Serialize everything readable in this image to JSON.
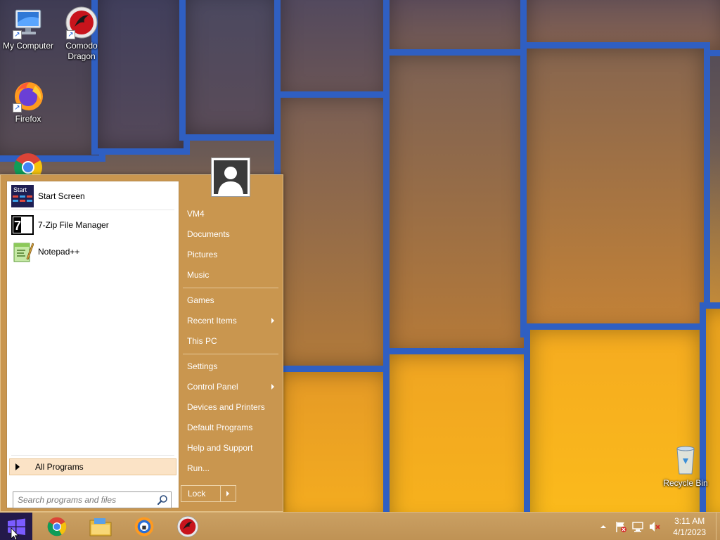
{
  "desktop": {
    "icons": [
      {
        "label": "My Computer"
      },
      {
        "label": "Comodo Dragon"
      },
      {
        "label": "Firefox"
      },
      {
        "label": "Google Chrome"
      },
      {
        "label": "Recycle Bin"
      }
    ]
  },
  "start_menu": {
    "left_items": [
      {
        "label": "Start Screen",
        "icon_text": "Start"
      },
      {
        "label": "7-Zip File Manager",
        "icon_text": "7z"
      },
      {
        "label": "Notepad++"
      }
    ],
    "all_programs_label": "All Programs",
    "search_placeholder": "Search programs and files",
    "right_items": [
      {
        "label": "VM4"
      },
      {
        "label": "Documents"
      },
      {
        "label": "Pictures"
      },
      {
        "label": "Music"
      },
      {
        "label": "Games"
      },
      {
        "label": "Recent Items"
      },
      {
        "label": "This PC"
      },
      {
        "label": "Settings"
      },
      {
        "label": "Control Panel"
      },
      {
        "label": "Devices and Printers"
      },
      {
        "label": "Default Programs"
      },
      {
        "label": "Help and Support"
      },
      {
        "label": "Run..."
      }
    ],
    "lock_label": "Lock"
  },
  "taskbar": {
    "apps": [
      "chrome-icon",
      "file-explorer-icon",
      "comodo-ice-dragon-icon",
      "comodo-dragon-icon"
    ],
    "tray_icons": [
      "show-hidden-icons-icon",
      "action-center-flag-icon",
      "network-icon",
      "volume-muted-icon"
    ],
    "clock": {
      "time": "3:11 AM",
      "date": "4/1/2023"
    }
  },
  "colors": {
    "menu_bg": "#c9964f",
    "taskbar_bg": "#c49858",
    "wallpaper_frame": "#2f5fc2",
    "all_programs_bg": "#fbe3c6"
  }
}
